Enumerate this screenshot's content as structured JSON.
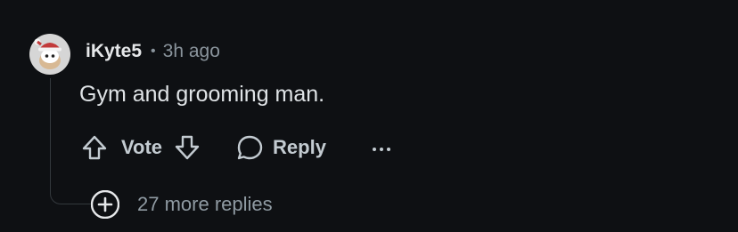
{
  "comment": {
    "username": "iKyte5",
    "separator": "•",
    "time": "3h ago",
    "text": "Gym and grooming man.",
    "avatar_icon": "snoo-santa-hat-avatar"
  },
  "actions": {
    "vote_label": "Vote",
    "reply_label": "Reply",
    "more_label": "...",
    "upvote_icon": "arrow-up-outline-icon",
    "downvote_icon": "arrow-down-outline-icon",
    "reply_icon": "speech-bubble-icon",
    "more_icon": "ellipsis-icon"
  },
  "more_replies": {
    "label": "27 more replies",
    "icon": "plus-circle-icon"
  },
  "colors": {
    "background": "#0e1013",
    "text_primary": "#e6e8ea",
    "text_secondary": "#8a949c",
    "action_text": "#c3cbd1",
    "thread_line": "#33383d"
  }
}
